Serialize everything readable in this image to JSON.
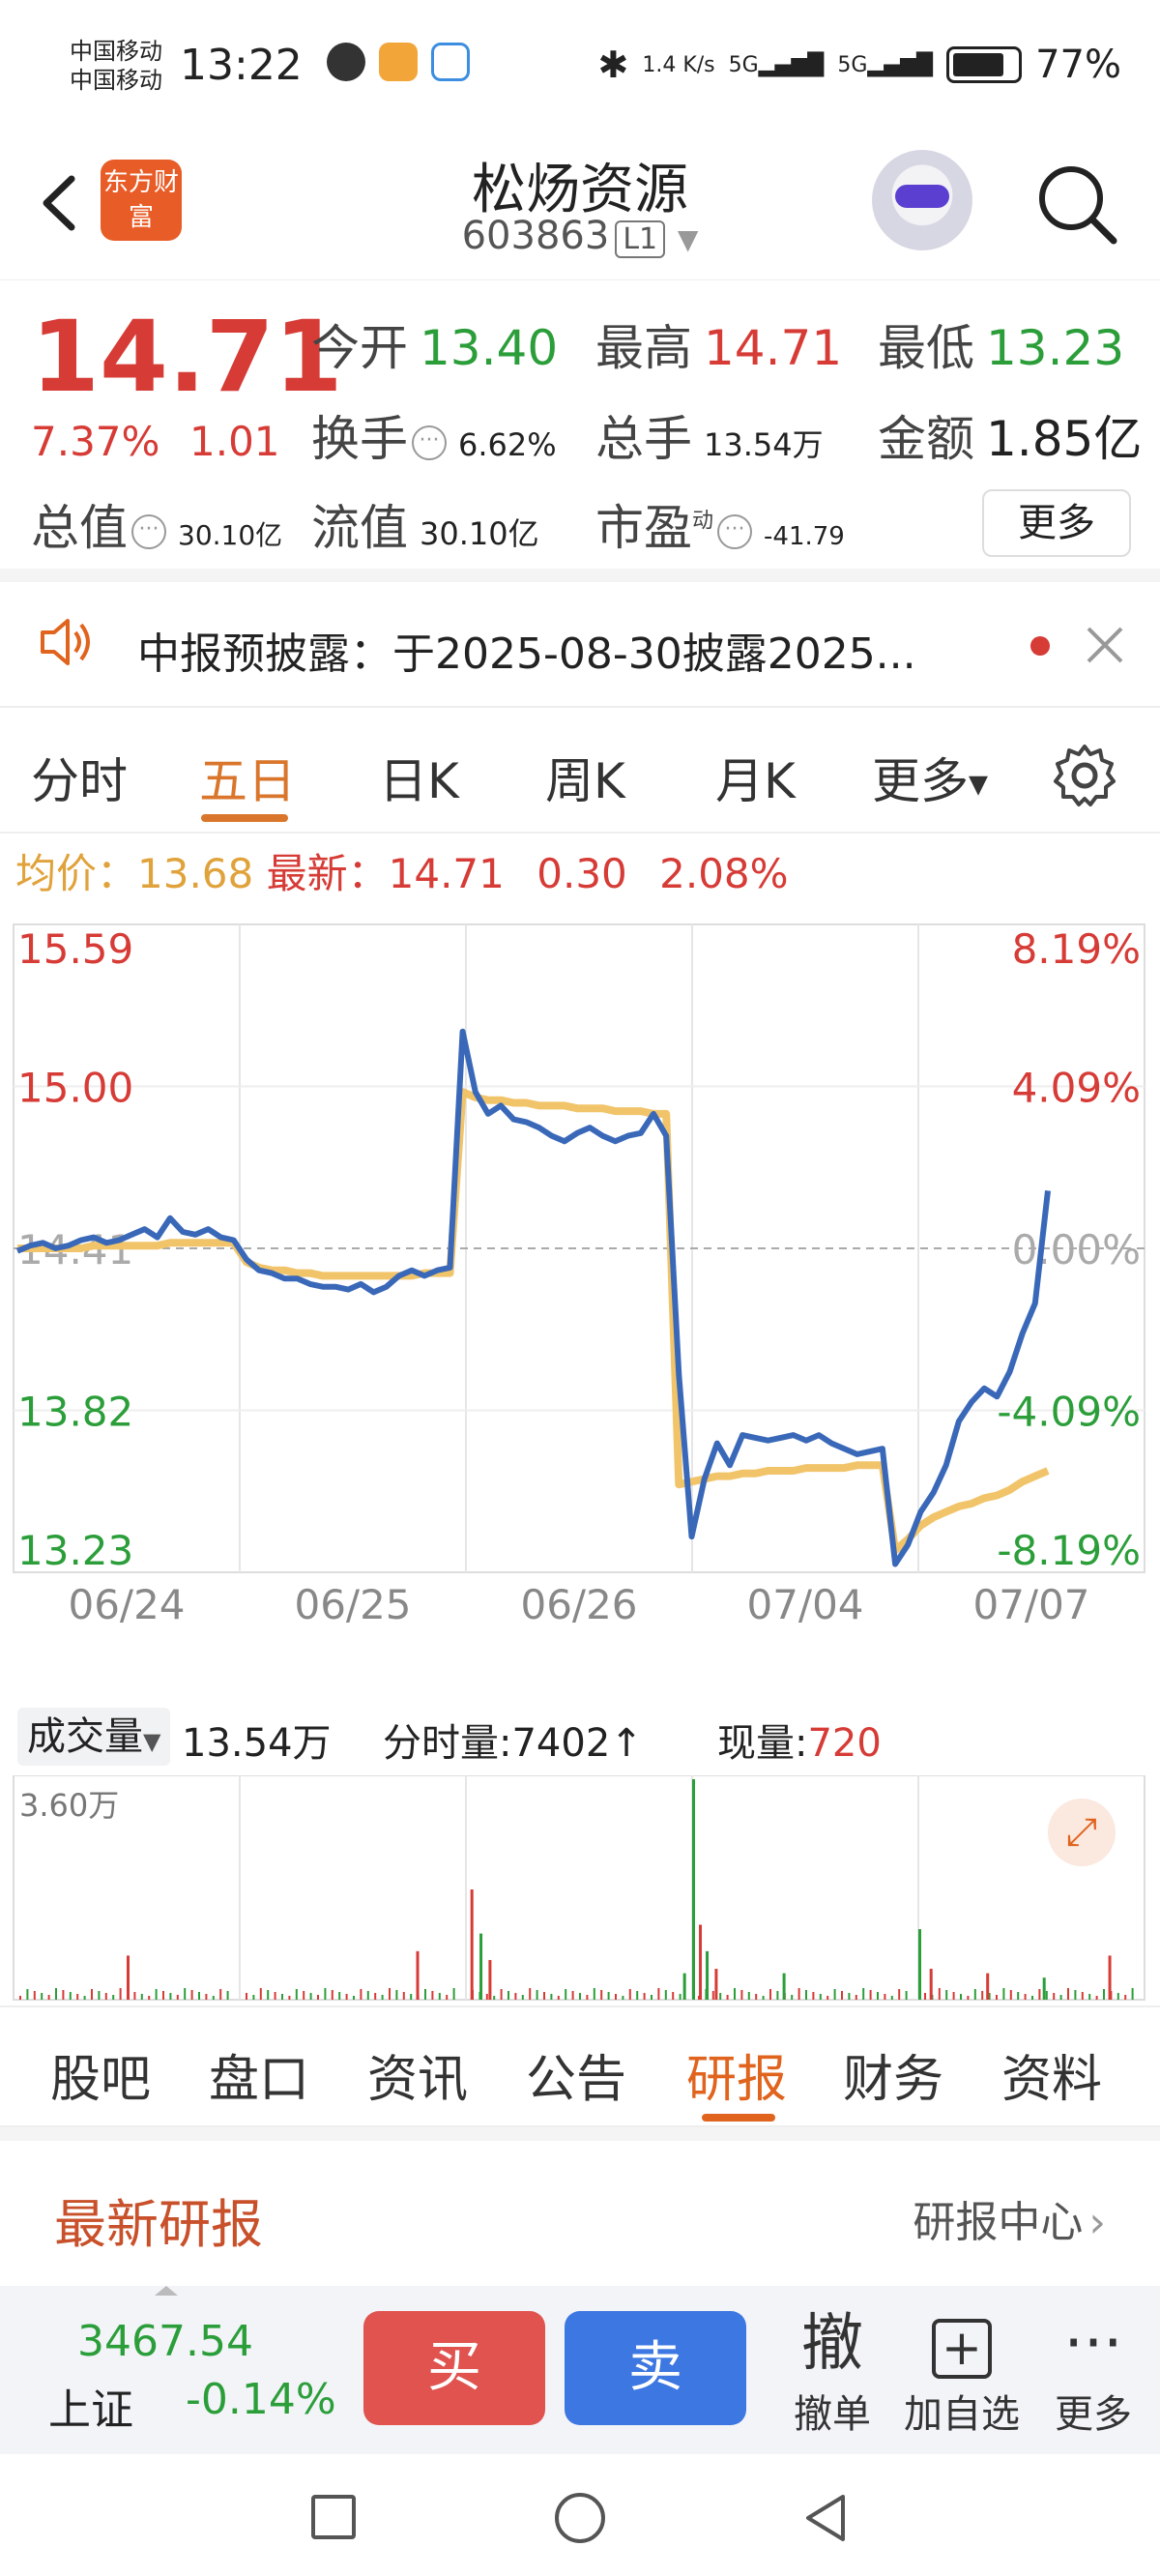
{
  "status": {
    "carrier1": "中国移动",
    "carrier2": "中国移动",
    "time": "13:22",
    "speed": "1.4 K/s",
    "net1": "5G",
    "net2": "5G",
    "battery": "77%"
  },
  "header": {
    "brand": "东方财富",
    "title": "松炀资源",
    "code": "603863",
    "level": "L1"
  },
  "quote": {
    "price": "14.71",
    "change_pct": "7.37%",
    "change": "1.01",
    "open_label": "今开",
    "open": "13.40",
    "high_label": "最高",
    "high": "14.71",
    "low_label": "最低",
    "low": "13.23",
    "turnover_label": "换手",
    "turnover": "6.62%",
    "volume_label": "总手",
    "volume": "13.54万",
    "amount_label": "金额",
    "amount": "1.85亿",
    "mcap_label": "总值",
    "mcap": "30.10亿",
    "float_label": "流值",
    "float": "30.10亿",
    "pe_label": "市盈",
    "pe_sup": "动",
    "pe": "-41.79",
    "more": "更多"
  },
  "notice": {
    "text": "中报预披露：于2025-08-30披露2025..."
  },
  "period_tabs": [
    "分时",
    "五日",
    "日K",
    "周K",
    "月K",
    "更多"
  ],
  "period_active": 1,
  "avg_row": {
    "avg_label": "均价：",
    "avg": "13.68",
    "latest_label": "最新：",
    "latest": "14.71",
    "change": "0.30",
    "pct": "2.08%"
  },
  "chart_data": {
    "type": "line",
    "y_left_labels": [
      "15.59",
      "15.00",
      "14.41",
      "13.82",
      "13.23"
    ],
    "y_right_labels": [
      "8.19%",
      "4.09%",
      "0.00%",
      "-4.09%",
      "-8.19%"
    ],
    "ylim": [
      13.23,
      15.59
    ],
    "x_labels": [
      "06/24",
      "06/25",
      "06/26",
      "07/04",
      "07/07"
    ],
    "series": [
      {
        "values": [
          14.4,
          14.42,
          14.43,
          14.41,
          14.42,
          14.44,
          14.45,
          14.43,
          14.44,
          14.46,
          14.48,
          14.45,
          14.52,
          14.47,
          14.46,
          14.48,
          14.45,
          14.44,
          14.37,
          14.33,
          14.32,
          14.3,
          14.3,
          14.28,
          14.27,
          14.27,
          14.26,
          14.28,
          14.25,
          14.27,
          14.31,
          14.33,
          14.31,
          14.33,
          14.34,
          15.2,
          14.98,
          14.9,
          14.93,
          14.88,
          14.87,
          14.85,
          14.82,
          14.8,
          14.83,
          14.85,
          14.82,
          14.8,
          14.82,
          14.83,
          14.9,
          14.82,
          13.95,
          13.36,
          13.57,
          13.7,
          13.62,
          13.73,
          13.72,
          13.71,
          13.72,
          13.73,
          13.71,
          13.73,
          13.7,
          13.68,
          13.66,
          13.67,
          13.68,
          13.26,
          13.33,
          13.45,
          13.52,
          13.62,
          13.78,
          13.85,
          13.9,
          13.87,
          13.96,
          14.1,
          14.21,
          14.62
        ]
      },
      {
        "values": [
          14.41,
          14.41,
          14.41,
          14.41,
          14.41,
          14.41,
          14.42,
          14.42,
          14.42,
          14.42,
          14.42,
          14.42,
          14.43,
          14.43,
          14.43,
          14.43,
          14.43,
          14.43,
          14.36,
          14.34,
          14.33,
          14.33,
          14.32,
          14.32,
          14.31,
          14.31,
          14.31,
          14.31,
          14.31,
          14.31,
          14.31,
          14.31,
          14.32,
          14.32,
          14.32,
          14.98,
          14.96,
          14.95,
          14.95,
          14.94,
          14.94,
          14.93,
          14.93,
          14.93,
          14.92,
          14.92,
          14.92,
          14.91,
          14.91,
          14.91,
          14.9,
          14.9,
          13.55,
          13.56,
          13.57,
          13.58,
          13.58,
          13.59,
          13.59,
          13.6,
          13.6,
          13.6,
          13.61,
          13.61,
          13.61,
          13.61,
          13.62,
          13.62,
          13.62,
          13.31,
          13.35,
          13.4,
          13.43,
          13.45,
          13.47,
          13.48,
          13.5,
          13.51,
          13.53,
          13.56,
          13.58,
          13.6
        ]
      }
    ]
  },
  "volume": {
    "label": "成交量",
    "total": "13.54万",
    "tick_label": "分时量:7402↑",
    "now_label": "现量:",
    "now": "720",
    "max": "3.60万",
    "bars": [
      {
        "day": 0,
        "pos": 0.5,
        "v": 0.2,
        "c": "red"
      },
      {
        "day": 1,
        "pos": 0.78,
        "v": 0.22,
        "c": "red"
      },
      {
        "day": 2,
        "pos": 0.02,
        "v": 0.5,
        "c": "red"
      },
      {
        "day": 2,
        "pos": 0.06,
        "v": 0.3,
        "c": "green"
      },
      {
        "day": 2,
        "pos": 0.1,
        "v": 0.18,
        "c": "red"
      },
      {
        "day": 2,
        "pos": 0.96,
        "v": 0.12,
        "c": "green"
      },
      {
        "day": 3,
        "pos": 0.0,
        "v": 1.0,
        "c": "green"
      },
      {
        "day": 3,
        "pos": 0.03,
        "v": 0.34,
        "c": "red"
      },
      {
        "day": 3,
        "pos": 0.06,
        "v": 0.22,
        "c": "green"
      },
      {
        "day": 3,
        "pos": 0.1,
        "v": 0.14,
        "c": "red"
      },
      {
        "day": 3,
        "pos": 0.4,
        "v": 0.12,
        "c": "green"
      },
      {
        "day": 4,
        "pos": 0.0,
        "v": 0.32,
        "c": "green"
      },
      {
        "day": 4,
        "pos": 0.05,
        "v": 0.14,
        "c": "red"
      },
      {
        "day": 4,
        "pos": 0.3,
        "v": 0.12,
        "c": "red"
      },
      {
        "day": 4,
        "pos": 0.55,
        "v": 0.1,
        "c": "green"
      },
      {
        "day": 4,
        "pos": 0.84,
        "v": 0.2,
        "c": "red"
      }
    ]
  },
  "bottom_tabs": [
    "股吧",
    "盘口",
    "资讯",
    "公告",
    "研报",
    "财务",
    "资料"
  ],
  "bottom_active": 4,
  "research": {
    "title": "最新研报",
    "center": "研报中心"
  },
  "trade": {
    "index_value": "3467.54",
    "index_name": "上证",
    "index_pct": "-0.14%",
    "buy": "买",
    "sell": "卖",
    "cancel_big": "撤",
    "cancel": "撤单",
    "watch": "加自选",
    "more": "更多"
  },
  "colors": {
    "up": "#d63b36",
    "down": "#2b9e3a",
    "price_line": "#3a68b8",
    "avg_line": "#f1c46a",
    "accent": "#e0641e"
  }
}
